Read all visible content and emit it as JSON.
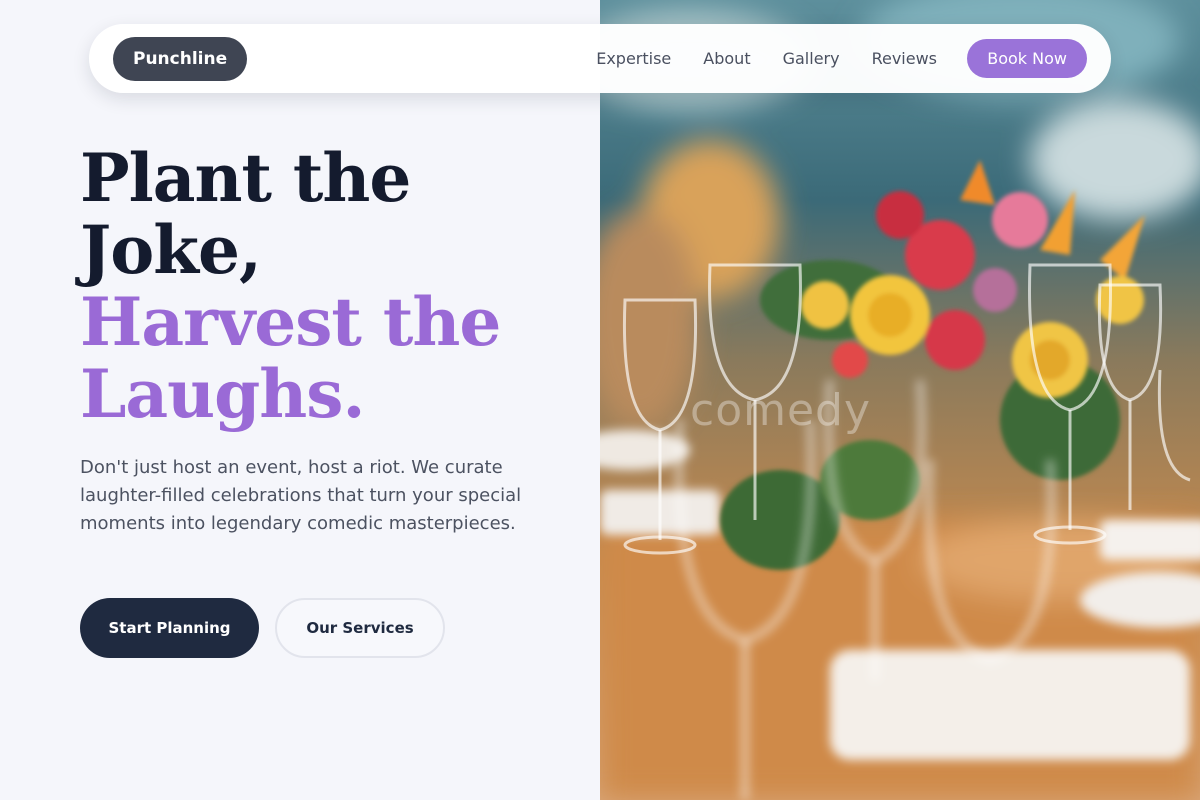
{
  "nav": {
    "brand": "Punchline",
    "links": [
      "Expertise",
      "About",
      "Gallery",
      "Reviews"
    ],
    "cta": "Book Now"
  },
  "hero": {
    "headline_line1": "Plant the",
    "headline_line2": "Joke,",
    "headline_line3": "Harvest the",
    "headline_line4": "Laughs.",
    "description": "Don't just host an event, host a riot. We curate laughter-filled celebrations that turn your special moments into legendary comedic masterpieces.",
    "primary_button": "Start Planning",
    "secondary_button": "Our Services",
    "watermark": "comedy"
  },
  "colors": {
    "accent": "#9a73d9",
    "headline_dark": "#141b2e",
    "headline_accent": "#9a6ad6",
    "primary_button": "#1f2a40",
    "brand_pill": "#3f4553"
  }
}
